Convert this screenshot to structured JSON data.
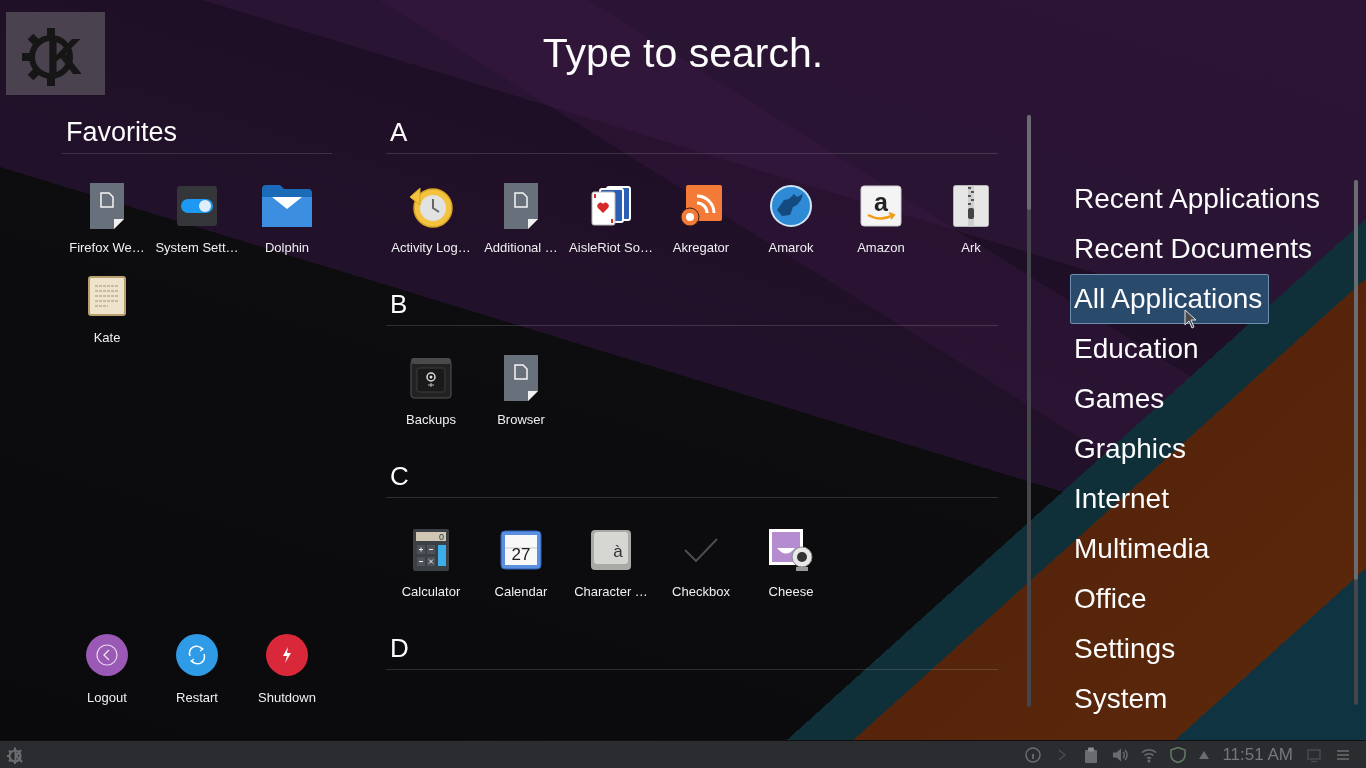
{
  "launcher_logo": {
    "glyph": "K"
  },
  "search": {
    "placeholder": "Type to search."
  },
  "favorites": {
    "title": "Favorites",
    "items": [
      {
        "label": "Firefox We…",
        "kind": "page"
      },
      {
        "label": "System Sett…",
        "kind": "toggle"
      },
      {
        "label": "Dolphin",
        "kind": "folder"
      },
      {
        "label": "Kate",
        "kind": "notepad"
      }
    ]
  },
  "session_buttons": [
    {
      "label": "Logout",
      "kind": "logout"
    },
    {
      "label": "Restart",
      "kind": "restart"
    },
    {
      "label": "Shutdown",
      "kind": "shutdown"
    }
  ],
  "application_sections": [
    {
      "letter": "A",
      "items": [
        {
          "label": "Activity Log…",
          "kind": "history"
        },
        {
          "label": "Additional …",
          "kind": "page"
        },
        {
          "label": "AisleRiot So…",
          "kind": "cards"
        },
        {
          "label": "Akregator",
          "kind": "feed"
        },
        {
          "label": "Amarok",
          "kind": "wolf"
        },
        {
          "label": "Amazon",
          "kind": "lettertile",
          "glyph": "a"
        },
        {
          "label": "Ark",
          "kind": "zipper"
        }
      ]
    },
    {
      "letter": "B",
      "items": [
        {
          "label": "Backups",
          "kind": "safe"
        },
        {
          "label": "Browser",
          "kind": "page"
        }
      ]
    },
    {
      "letter": "C",
      "items": [
        {
          "label": "Calculator",
          "kind": "calculator",
          "glyph": "0"
        },
        {
          "label": "Calendar",
          "kind": "calendar",
          "glyph": "27"
        },
        {
          "label": "Character …",
          "kind": "keycap",
          "glyph": "à"
        },
        {
          "label": "Checkbox",
          "kind": "check"
        },
        {
          "label": "Cheese",
          "kind": "webcam"
        }
      ]
    },
    {
      "letter": "D"
    }
  ],
  "categories": [
    {
      "label": "Recent Applications",
      "selected": false
    },
    {
      "label": "Recent Documents",
      "selected": false
    },
    {
      "label": "All Applications",
      "selected": true
    },
    {
      "label": "Education",
      "selected": false
    },
    {
      "label": "Games",
      "selected": false
    },
    {
      "label": "Graphics",
      "selected": false
    },
    {
      "label": "Internet",
      "selected": false
    },
    {
      "label": "Multimedia",
      "selected": false
    },
    {
      "label": "Office",
      "selected": false
    },
    {
      "label": "Settings",
      "selected": false
    },
    {
      "label": "System",
      "selected": false
    }
  ],
  "taskbar": {
    "clock": "11:51 AM"
  }
}
